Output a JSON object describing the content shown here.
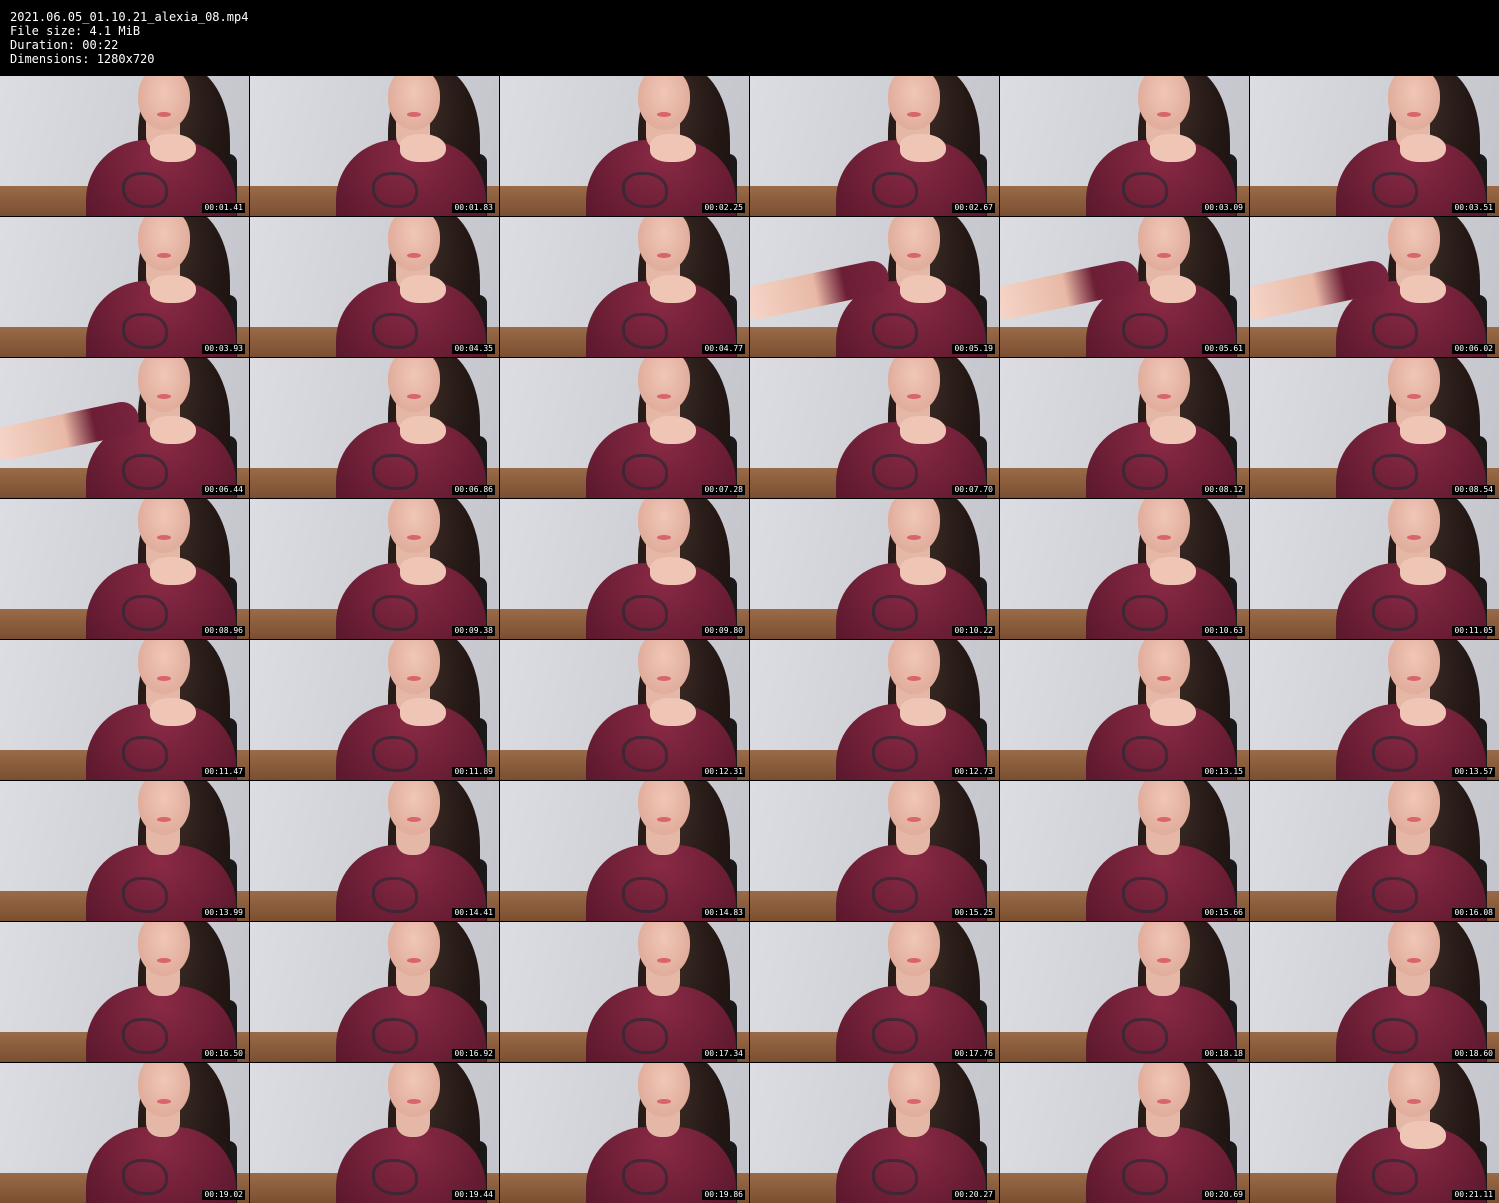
{
  "header": {
    "filename": "2021.06.05_01.10.21_alexia_08.mp4",
    "file_size": "File size: 4.1 MiB",
    "duration": "Duration: 00:22",
    "dimensions": "Dimensions: 1280x720"
  },
  "thumbnails": [
    {
      "timestamp": "00:01.41"
    },
    {
      "timestamp": "00:01.83"
    },
    {
      "timestamp": "00:02.25"
    },
    {
      "timestamp": "00:02.67"
    },
    {
      "timestamp": "00:03.09"
    },
    {
      "timestamp": "00:03.51"
    },
    {
      "timestamp": "00:03.93"
    },
    {
      "timestamp": "00:04.35"
    },
    {
      "timestamp": "00:04.77"
    },
    {
      "timestamp": "00:05.19"
    },
    {
      "timestamp": "00:05.61"
    },
    {
      "timestamp": "00:06.02"
    },
    {
      "timestamp": "00:06.44"
    },
    {
      "timestamp": "00:06.86"
    },
    {
      "timestamp": "00:07.28"
    },
    {
      "timestamp": "00:07.70"
    },
    {
      "timestamp": "00:08.12"
    },
    {
      "timestamp": "00:08.54"
    },
    {
      "timestamp": "00:08.96"
    },
    {
      "timestamp": "00:09.38"
    },
    {
      "timestamp": "00:09.80"
    },
    {
      "timestamp": "00:10.22"
    },
    {
      "timestamp": "00:10.63"
    },
    {
      "timestamp": "00:11.05"
    },
    {
      "timestamp": "00:11.47"
    },
    {
      "timestamp": "00:11.89"
    },
    {
      "timestamp": "00:12.31"
    },
    {
      "timestamp": "00:12.73"
    },
    {
      "timestamp": "00:13.15"
    },
    {
      "timestamp": "00:13.57"
    },
    {
      "timestamp": "00:13.99"
    },
    {
      "timestamp": "00:14.41"
    },
    {
      "timestamp": "00:14.83"
    },
    {
      "timestamp": "00:15.25"
    },
    {
      "timestamp": "00:15.66"
    },
    {
      "timestamp": "00:16.08"
    },
    {
      "timestamp": "00:16.50"
    },
    {
      "timestamp": "00:16.92"
    },
    {
      "timestamp": "00:17.34"
    },
    {
      "timestamp": "00:17.76"
    },
    {
      "timestamp": "00:18.18"
    },
    {
      "timestamp": "00:18.60"
    },
    {
      "timestamp": "00:19.02"
    },
    {
      "timestamp": "00:19.44"
    },
    {
      "timestamp": "00:19.86"
    },
    {
      "timestamp": "00:20.27"
    },
    {
      "timestamp": "00:20.69"
    },
    {
      "timestamp": "00:21.11"
    }
  ],
  "colors": {
    "background": "#000000",
    "text": "#ffffff",
    "shirt": "#6b1e35"
  }
}
